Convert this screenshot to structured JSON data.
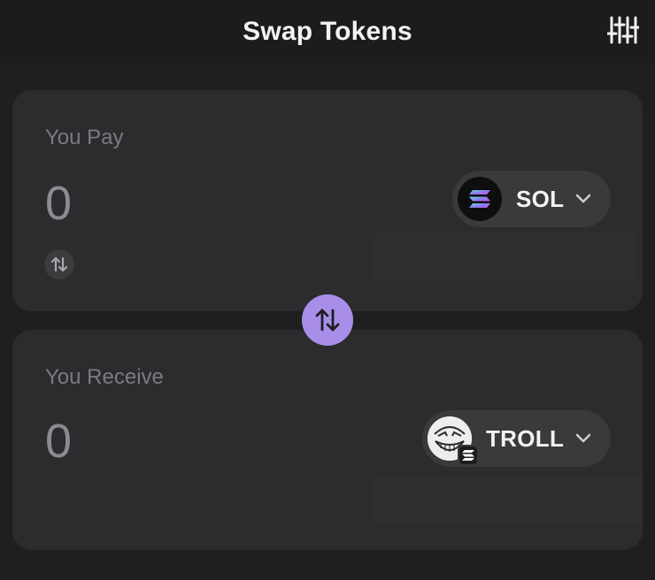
{
  "header": {
    "title": "Swap Tokens",
    "settings_icon": "sliders-icon"
  },
  "pay": {
    "label": "You Pay",
    "amount": "0",
    "token": {
      "symbol": "SOL",
      "icon": "solana-logo-icon"
    },
    "toggle_icon": "swap-arrows-icon"
  },
  "swap_button": {
    "icon": "swap-arrows-icon",
    "color": "#a88ee8"
  },
  "receive": {
    "label": "You Receive",
    "amount": "0",
    "token": {
      "symbol": "TROLL",
      "icon": "troll-face-icon",
      "badge_icon": "solana-badge-icon"
    }
  }
}
